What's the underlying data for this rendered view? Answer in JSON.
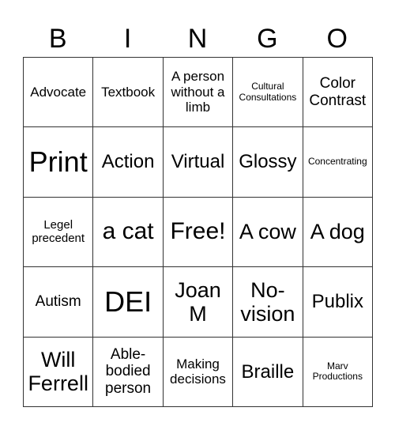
{
  "title_letters": [
    "B",
    "I",
    "N",
    "G",
    "O"
  ],
  "cells": [
    [
      "Advocate",
      "Textbook",
      "A person without a limb",
      "Cultural Consultations",
      "Color Contrast"
    ],
    [
      "Print",
      "Action",
      "Virtual",
      "Glossy",
      "Concentrating"
    ],
    [
      "Legel precedent",
      "a cat",
      "Free!",
      "A cow",
      "A dog"
    ],
    [
      "Autism",
      "DEI",
      "Joan M",
      "No-vision",
      "Publix"
    ],
    [
      "Will Ferrell",
      "Able-bodied person",
      "Making decisions",
      "Braille",
      "Marv Productions"
    ]
  ],
  "colors": {
    "grid_line": "#333333",
    "text": "#000000",
    "background": "#ffffff"
  }
}
